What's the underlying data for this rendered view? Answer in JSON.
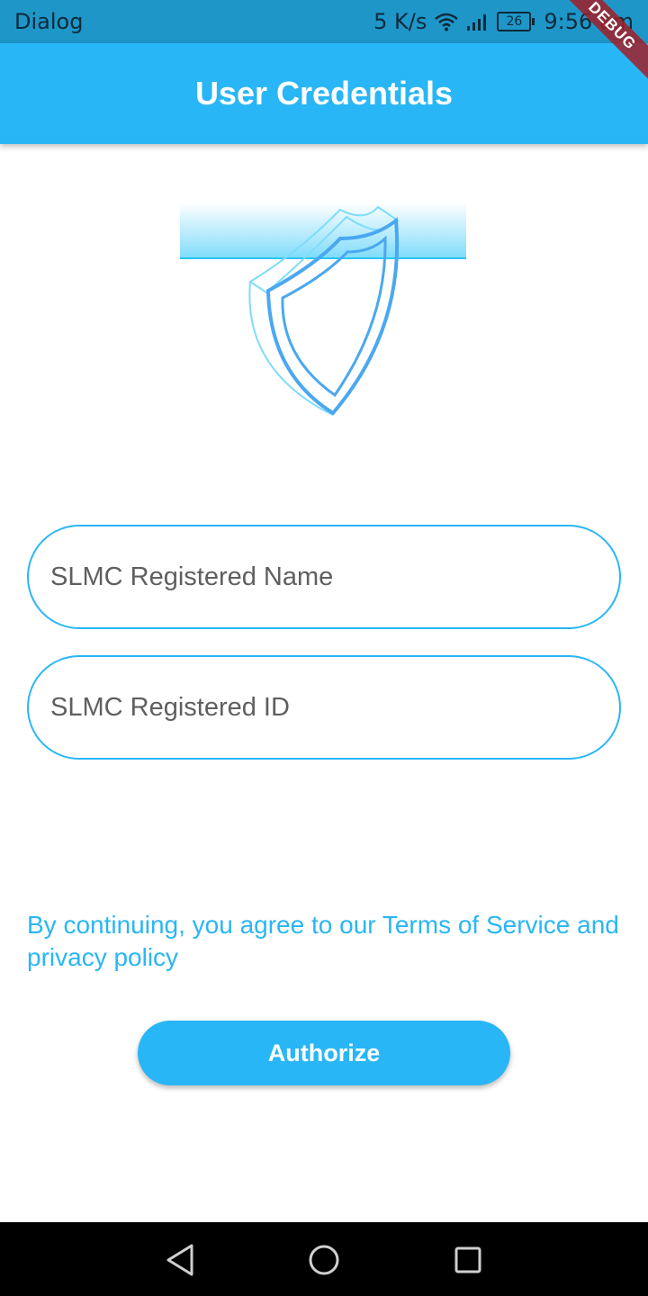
{
  "status_bar": {
    "app_name": "Dialog",
    "network_speed": "5 K/s",
    "battery": "26",
    "time": "9:56 am",
    "icons": [
      "wifi-icon",
      "signal-icon",
      "battery-icon"
    ]
  },
  "debug_banner": {
    "label": "DEBUG",
    "color": "#a01e28"
  },
  "app_bar": {
    "title": "User Credentials",
    "color": "#29b6f6"
  },
  "illustration": {
    "icon": "shield-icon"
  },
  "form": {
    "name_field": {
      "placeholder": "SLMC Registered Name",
      "value": ""
    },
    "id_field": {
      "placeholder": "SLMC Registered ID",
      "value": ""
    }
  },
  "terms": {
    "text": "By continuing, you agree to our Terms of Service and privacy policy"
  },
  "authorize_button": {
    "label": "Authorize"
  },
  "nav_bar": {
    "icons": [
      "back-icon",
      "home-icon",
      "recent-apps-icon"
    ]
  },
  "colors": {
    "accent": "#29b6f6",
    "status_bar": "#1e96c8",
    "nav_bar": "#000000"
  }
}
